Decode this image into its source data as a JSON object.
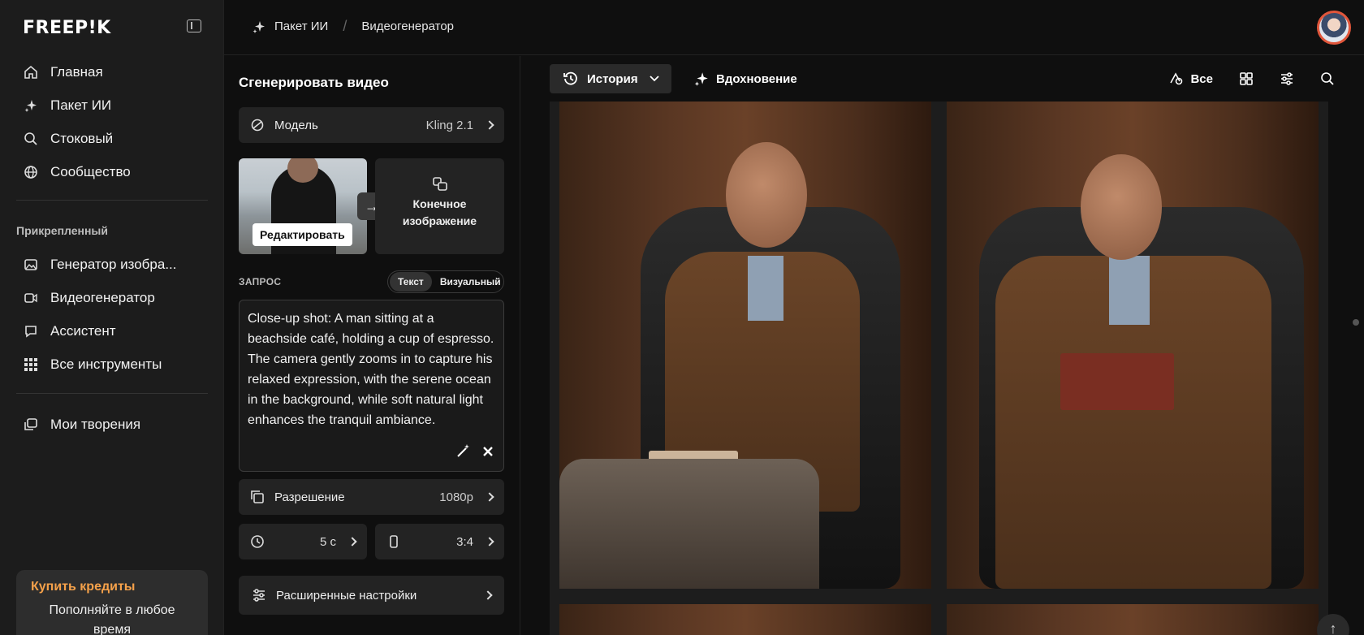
{
  "app": {
    "logo": "FREEP!K"
  },
  "sidebar": {
    "main_items": [
      {
        "label": "Главная",
        "icon": "home-icon"
      },
      {
        "label": "Пакет ИИ",
        "icon": "sparkle-icon"
      },
      {
        "label": "Стоковый",
        "icon": "search-icon"
      },
      {
        "label": "Сообщество",
        "icon": "globe-icon"
      }
    ],
    "pinned_label": "Прикрепленный",
    "pinned_items": [
      {
        "label": "Генератор изобра...",
        "icon": "image-icon"
      },
      {
        "label": "Видеогенератор",
        "icon": "video-icon"
      },
      {
        "label": "Ассистент",
        "icon": "chat-icon"
      },
      {
        "label": "Все инструменты",
        "icon": "grid-icon"
      }
    ],
    "creations": {
      "label": "Мои творения",
      "icon": "library-icon"
    },
    "credits": {
      "title": "Купить кредиты",
      "subtitle": "Пополняйте в любое время"
    }
  },
  "breadcrumb": {
    "items": [
      "Пакет ИИ",
      "Видеогенератор"
    ],
    "separator": "/"
  },
  "panel": {
    "title": "Сгенерировать видео",
    "model": {
      "label": "Модель",
      "value": "Kling 2.1"
    },
    "start_image": {
      "edit_label": "Редактировать"
    },
    "end_image": {
      "label": "Конечное изображение"
    },
    "prompt": {
      "label": "ЗАПРОС",
      "modes": [
        "Текст",
        "Визуальный"
      ],
      "active_mode": "Текст",
      "text": "Close-up shot: A man sitting at a beachside café, holding a cup of espresso. The camera gently zooms in to capture his relaxed expression, with the serene ocean in the background, while soft natural light enhances the tranquil ambiance."
    },
    "resolution": {
      "label": "Разрешение",
      "value": "1080p"
    },
    "duration": {
      "value": "5 с"
    },
    "aspect": {
      "value": "3:4"
    },
    "advanced": {
      "label": "Расширенные настройки"
    }
  },
  "main": {
    "history_tab": "История",
    "inspiration_tab": "Вдохновение",
    "filter_all": "Все"
  },
  "colors": {
    "accent": "#f5a14a",
    "avatar_ring": "#e0563b",
    "bg": "#0f0f0f",
    "sidebar": "#1c1c1c"
  }
}
